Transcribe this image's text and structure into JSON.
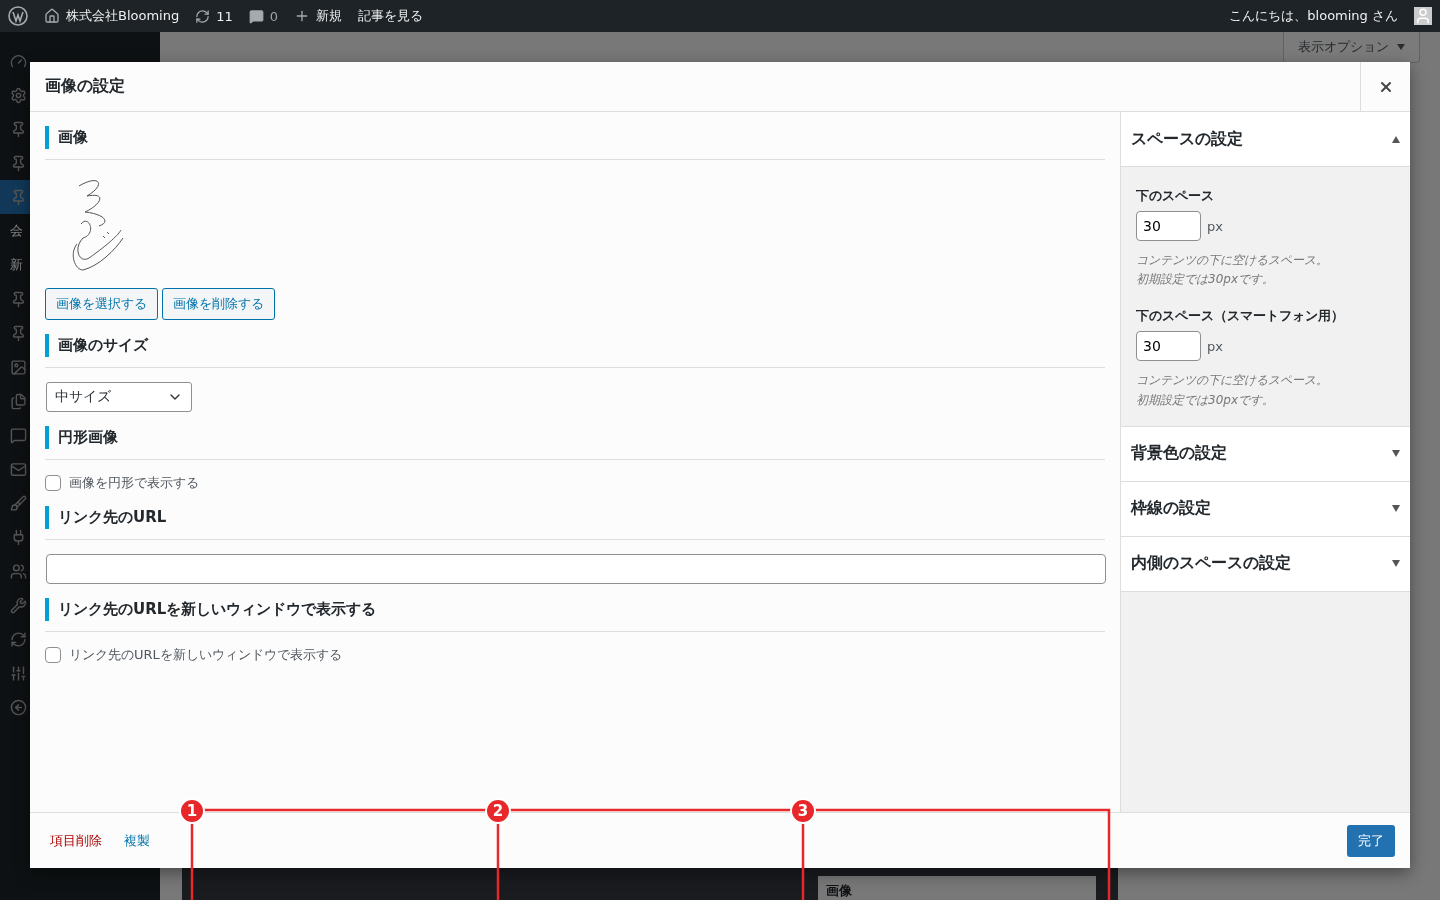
{
  "admin_bar": {
    "site": "株式会社Blooming",
    "updates": "11",
    "comments": "0",
    "new": "新規",
    "view": "記事を見る",
    "greeting": "こんにちは、blooming さん"
  },
  "background": {
    "screen_options": "表示オプション",
    "menu_fragments": [
      "会",
      "新"
    ],
    "block_label": "画像"
  },
  "modal": {
    "title": "画像の設定",
    "sections": [
      {
        "kind": "image",
        "heading": "画像",
        "buttons": [
          "画像を選択する",
          "画像を削除する"
        ]
      },
      {
        "kind": "select",
        "heading": "画像のサイズ",
        "value": "中サイズ"
      },
      {
        "kind": "checkbox",
        "heading": "円形画像",
        "label": "画像を円形で表示する",
        "checked": false
      },
      {
        "kind": "text",
        "heading": "リンク先のURL"
      },
      {
        "kind": "checkbox",
        "heading": "リンク先のURLを新しいウィンドウで表示する",
        "label": "リンク先のURLを新しいウィンドウで表示する",
        "checked": false
      }
    ],
    "panels": [
      {
        "title": "スペースの設定",
        "expanded": true,
        "fields": [
          {
            "label": "下のスペース",
            "value": "30",
            "unit": "px",
            "help": [
              "コンテンツの下に空けるスペース。",
              "初期設定では30pxです。"
            ]
          },
          {
            "label": "下のスペース（スマートフォン用）",
            "value": "30",
            "unit": "px",
            "help": [
              "コンテンツの下に空けるスペース。",
              "初期設定では30pxです。"
            ]
          }
        ]
      },
      {
        "title": "背景色の設定",
        "expanded": false
      },
      {
        "title": "枠線の設定",
        "expanded": false
      },
      {
        "title": "内側のスペースの設定",
        "expanded": false
      }
    ],
    "footer": {
      "delete": "項目削除",
      "duplicate": "複製",
      "done": "完了"
    }
  },
  "annotations": [
    {
      "number": "1"
    },
    {
      "number": "2"
    },
    {
      "number": "3"
    }
  ]
}
